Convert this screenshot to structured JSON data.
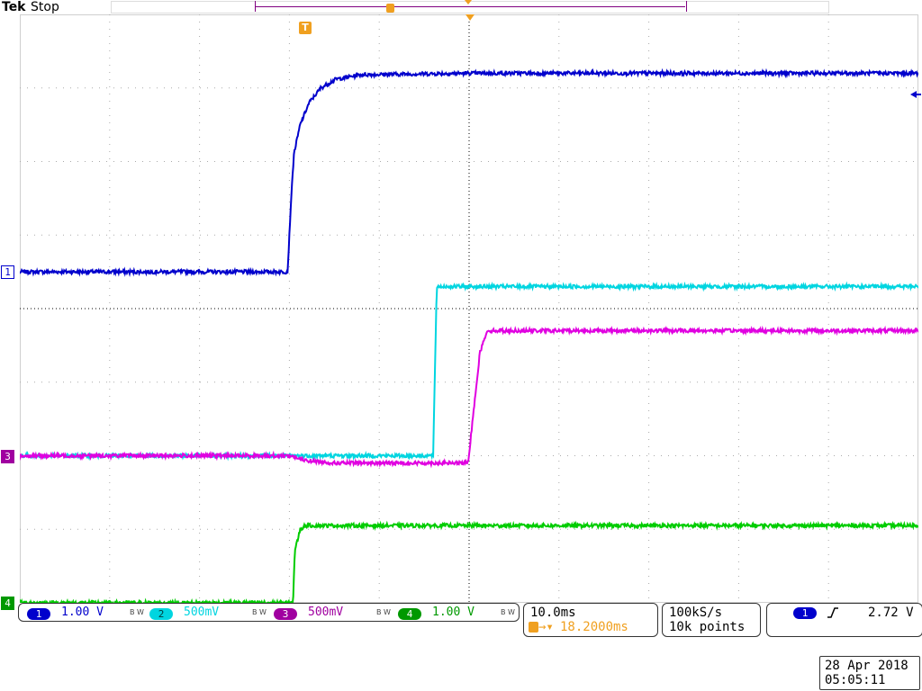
{
  "header": {
    "brand": "Tek",
    "status": "Stop"
  },
  "trigger_marker_label": "T",
  "chart_data": {
    "type": "line",
    "x_unit": "ms",
    "xlim": [
      -50,
      50
    ],
    "ylim": [
      -4,
      4
    ],
    "grid": true,
    "series": [
      {
        "name": "1",
        "color": "#0000cc",
        "offset": 0.5,
        "scale": "1.00 V",
        "points": [
          [
            -50,
            0
          ],
          [
            -20.2,
            0
          ],
          [
            -19.8,
            1.0
          ],
          [
            -19.5,
            1.6
          ],
          [
            -18.8,
            2.0
          ],
          [
            -17.8,
            2.3
          ],
          [
            -16.5,
            2.5
          ],
          [
            -14.8,
            2.62
          ],
          [
            -12,
            2.68
          ],
          [
            0,
            2.7
          ],
          [
            50,
            2.7
          ]
        ]
      },
      {
        "name": "2",
        "color": "#00d5e0",
        "offset": -2.0,
        "scale": "500mV",
        "points": [
          [
            -50,
            0
          ],
          [
            -4.0,
            0
          ],
          [
            -3.6,
            2.3
          ],
          [
            50,
            2.3
          ]
        ]
      },
      {
        "name": "3",
        "color": "#e000e0",
        "offset": -2.0,
        "scale": "500mV",
        "points": [
          [
            -50,
            0
          ],
          [
            -19.8,
            0
          ],
          [
            -18.5,
            -0.06
          ],
          [
            -15,
            -0.1
          ],
          [
            -10,
            -0.1
          ],
          [
            -0.1,
            -0.1
          ],
          [
            0.4,
            0.5
          ],
          [
            1.2,
            1.4
          ],
          [
            2.0,
            1.7
          ],
          [
            50,
            1.7
          ]
        ]
      },
      {
        "name": "4",
        "color": "#00cc00",
        "offset": -4.0,
        "scale": "1.00 V",
        "points": [
          [
            -50,
            0
          ],
          [
            -19.6,
            0
          ],
          [
            -19.4,
            0.7
          ],
          [
            -18.8,
            1.0
          ],
          [
            -18.2,
            1.05
          ],
          [
            50,
            1.05
          ]
        ]
      }
    ]
  },
  "channels": [
    {
      "id": "1",
      "scale": "1.00 V",
      "color": "#0000cc",
      "bw": "B W"
    },
    {
      "id": "2",
      "scale": "500mV",
      "color": "#00d5e0",
      "bw": "B W"
    },
    {
      "id": "3",
      "scale": "500mV",
      "color": "#a000a0",
      "bw": "B W"
    },
    {
      "id": "4",
      "scale": "1.00 V",
      "color": "#009900",
      "bw": "B W"
    }
  ],
  "timebase": {
    "scale": "10.0ms",
    "trigger_position": "18.2000ms"
  },
  "acquisition": {
    "rate": "100kS/s",
    "record": "10k points"
  },
  "trigger": {
    "source": "1",
    "slope_icon": "rising-edge",
    "level": "2.72 V"
  },
  "datetime": {
    "date": "28 Apr  2018",
    "time": "05:05:11"
  }
}
